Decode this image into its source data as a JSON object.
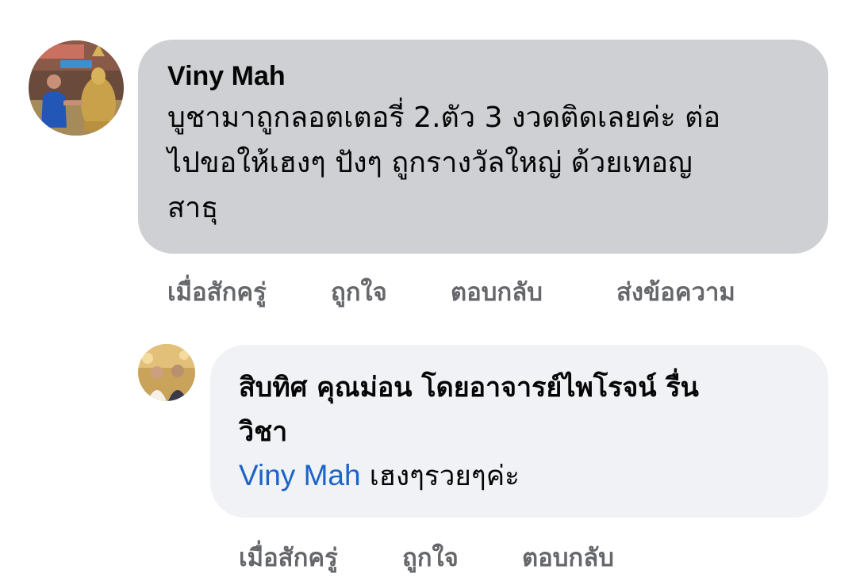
{
  "comment": {
    "author": "Viny Mah",
    "text_lines": [
      "บูชามาถูกลอตเตอรี่ 2.ตัว 3 งวดติดเลยค่ะ ต่อ",
      "ไปขอให้เฮงๆ ปังๆ ถูกรางวัลใหญ่ ด้วยเทอญ",
      "สาธุ"
    ],
    "actions": {
      "time": "เมื่อสักครู่",
      "like": "ถูกใจ",
      "reply": "ตอบกลับ",
      "message": "ส่งข้อความ"
    }
  },
  "reply": {
    "author_lines": [
      "สิบทิศ คุณม่อน โดยอาจารย์ไพโรจน์ รื่น",
      "วิชา"
    ],
    "mention": "Viny Mah",
    "text": "เฮงๆรวยๆค่ะ",
    "actions": {
      "time": "เมื่อสักครู่",
      "like": "ถูกใจ",
      "reply": "ตอบกลับ"
    }
  },
  "colors": {
    "main_bubble": "#ced0d4",
    "reply_bubble": "#f0f2f5",
    "action_text": "#65676b",
    "mention": "#1a64c8"
  }
}
